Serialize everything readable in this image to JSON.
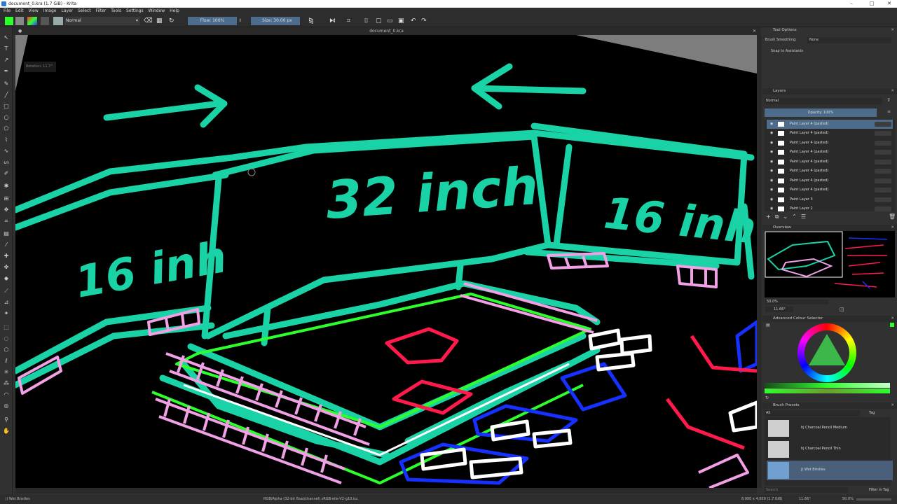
{
  "window": {
    "title": "document_0.kra (1.7 GiB) - Krita",
    "minimize": "–",
    "maximize": "□",
    "close": "✕"
  },
  "menu": [
    "File",
    "Edit",
    "View",
    "Image",
    "Layer",
    "Select",
    "Filter",
    "Tools",
    "Settings",
    "Window",
    "Help"
  ],
  "toolbar": {
    "blend_mode": "Normal",
    "flow": "Flow: 100%",
    "size_label": "Size:",
    "size_value": "30.00 px"
  },
  "document": {
    "tab_title": "document_0.kra",
    "rotation_label": "Rotation: 11.7°"
  },
  "canvas_labels": {
    "center": "32 inch",
    "left": "16 inh",
    "right": "16 inh"
  },
  "tool_options": {
    "title": "Tool Options",
    "brush_smoothing_label": "Brush Smoothing:",
    "brush_smoothing_value": "None",
    "snap_label": "Snap to Assistants"
  },
  "layers": {
    "title": "Layers",
    "blend_mode": "Normal",
    "opacity": "Opacity:  100%",
    "items": [
      "Paint Layer 4 (pasted)",
      "Paint Layer 4 (pasted)",
      "Paint Layer 4 (pasted)",
      "Paint Layer 4 (pasted)",
      "Paint Layer 4 (pasted)",
      "Paint Layer 4 (pasted)",
      "Paint Layer 4 (pasted)",
      "Paint Layer 4 (pasted)",
      "Paint Layer 3",
      "Paint Layer 2"
    ]
  },
  "overview": {
    "title": "Overview",
    "zoom": "50.0%",
    "rotation": "11.66°"
  },
  "colour_selector": {
    "title": "Advanced Colour Selector"
  },
  "brush_presets": {
    "title": "Brush Presets",
    "filter": "All",
    "tag": "Tag",
    "items": [
      "hj Charcoal Pencil Medium",
      "hj Charcoal Pencil Thin",
      "j) Wet Bristles"
    ],
    "search_placeholder": "Search",
    "filter_in_tag": "Filter in Tag"
  },
  "status": {
    "brush": "j) Wet Bristles",
    "color_space": "RGB/Alpha (32-bit float/channel)  sRGB-elle-V2-g10.icc",
    "image_size": "8,000 x 4,000 (1.7 GiB)",
    "rotation": "11.66°",
    "zoom": "50.0%"
  },
  "colors": {
    "teal": "#19d2a5",
    "pink": "#f2a0e6",
    "green": "#2dff2d",
    "red": "#ff1a4b",
    "blue": "#1530ff",
    "fg_color": "#2dff2d"
  }
}
